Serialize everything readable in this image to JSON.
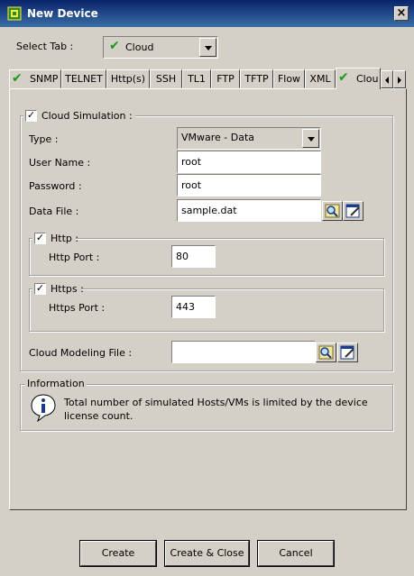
{
  "window": {
    "title": "New Device"
  },
  "select_tab": {
    "label": "Select Tab :",
    "value": "Cloud"
  },
  "tabs": [
    {
      "label": "SNMP",
      "checked": true
    },
    {
      "label": "TELNET",
      "checked": false
    },
    {
      "label": "Http(s)",
      "checked": false
    },
    {
      "label": "SSH",
      "checked": false
    },
    {
      "label": "TL1",
      "checked": false
    },
    {
      "label": "FTP",
      "checked": false
    },
    {
      "label": "TFTP",
      "checked": false
    },
    {
      "label": "Flow",
      "checked": false
    },
    {
      "label": "XML",
      "checked": false
    },
    {
      "label": "Clou",
      "checked": true
    }
  ],
  "cloud": {
    "simulation_label": "Cloud Simulation :",
    "type_label": "Type :",
    "type_value": "VMware - Data",
    "username_label": "User Name :",
    "username_value": "root",
    "password_label": "Password :",
    "password_value": "root",
    "datafile_label": "Data File :",
    "datafile_value": "sample.dat",
    "http_label": "Http :",
    "http_port_label": "Http Port :",
    "http_port_value": "80",
    "https_label": "Https :",
    "https_port_label": "Https Port :",
    "https_port_value": "443",
    "modeling_label": "Cloud Modeling File :",
    "modeling_value": ""
  },
  "information": {
    "title": "Information",
    "text_line1": "Total number of simulated Hosts/VMs is limited by the device",
    "text_line2": "license count."
  },
  "buttons": {
    "create": "Create",
    "create_close": "Create & Close",
    "cancel": "Cancel"
  }
}
